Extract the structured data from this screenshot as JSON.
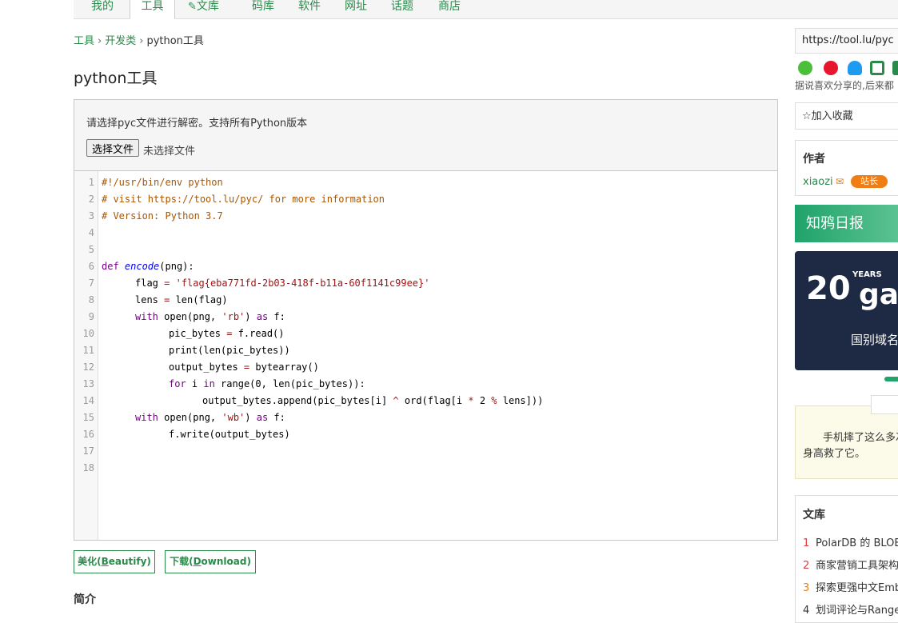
{
  "topnav": {
    "items": [
      "我的",
      "工具",
      "文库",
      "码库",
      "软件",
      "网址",
      "话题",
      "商店"
    ],
    "active_index": 1
  },
  "breadcrumb": [
    "工具",
    "开发类",
    "python工具"
  ],
  "page_title": "python工具",
  "panel": {
    "hint": "请选择pyc文件进行解密。支持所有Python版本",
    "file_button": "选择文件",
    "file_status": "未选择文件"
  },
  "editor": {
    "line_numbers": [
      "1",
      "2",
      "3",
      "4",
      "5",
      "6",
      "7",
      "8",
      "9",
      "10",
      "11",
      "12",
      "13",
      "14",
      "15",
      "16",
      "17",
      "18"
    ],
    "lines": [
      {
        "indent": 0,
        "parts": [
          {
            "t": "#!/usr/bin/env python",
            "c": "cm"
          }
        ]
      },
      {
        "indent": 0,
        "parts": [
          {
            "t": "# visit https://tool.lu/pyc/ for more information",
            "c": "cm"
          }
        ]
      },
      {
        "indent": 0,
        "parts": [
          {
            "t": "# Version: Python 3.7",
            "c": "cm"
          }
        ]
      },
      {
        "indent": 0,
        "parts": []
      },
      {
        "indent": 0,
        "parts": []
      },
      {
        "indent": 0,
        "parts": [
          {
            "t": "def ",
            "c": "kw"
          },
          {
            "t": "encode",
            "c": "fn"
          },
          {
            "t": "(png):",
            "c": ""
          }
        ]
      },
      {
        "indent": 1,
        "parts": [
          {
            "t": "flag ",
            "c": ""
          },
          {
            "t": "=",
            "c": "op"
          },
          {
            "t": " ",
            "c": ""
          },
          {
            "t": "'flag{eba771fd-2b03-418f-b11a-60f1141c99ee}'",
            "c": "str"
          }
        ]
      },
      {
        "indent": 1,
        "parts": [
          {
            "t": "lens ",
            "c": ""
          },
          {
            "t": "=",
            "c": "op"
          },
          {
            "t": " len(flag)",
            "c": ""
          }
        ]
      },
      {
        "indent": 1,
        "parts": [
          {
            "t": "with ",
            "c": "kw"
          },
          {
            "t": "open(png, ",
            "c": ""
          },
          {
            "t": "'rb'",
            "c": "str"
          },
          {
            "t": ") ",
            "c": ""
          },
          {
            "t": "as",
            "c": "kw"
          },
          {
            "t": " f:",
            "c": ""
          }
        ]
      },
      {
        "indent": 2,
        "parts": [
          {
            "t": "pic_bytes ",
            "c": ""
          },
          {
            "t": "=",
            "c": "op"
          },
          {
            "t": " f.read()",
            "c": ""
          }
        ]
      },
      {
        "indent": 2,
        "parts": [
          {
            "t": "print(len(pic_bytes))",
            "c": ""
          }
        ]
      },
      {
        "indent": 2,
        "parts": [
          {
            "t": "output_bytes ",
            "c": ""
          },
          {
            "t": "=",
            "c": "op"
          },
          {
            "t": " bytearray()",
            "c": ""
          }
        ]
      },
      {
        "indent": 2,
        "parts": [
          {
            "t": "for ",
            "c": "kw"
          },
          {
            "t": "i ",
            "c": ""
          },
          {
            "t": "in ",
            "c": "kw"
          },
          {
            "t": "range(0, len(pic_bytes)):",
            "c": ""
          }
        ]
      },
      {
        "indent": 3,
        "parts": [
          {
            "t": "output_bytes.append(pic_bytes[i] ",
            "c": ""
          },
          {
            "t": "^",
            "c": "op"
          },
          {
            "t": " ord(flag[i ",
            "c": ""
          },
          {
            "t": "*",
            "c": "op"
          },
          {
            "t": " 2 ",
            "c": ""
          },
          {
            "t": "%",
            "c": "op"
          },
          {
            "t": " lens]))",
            "c": ""
          }
        ]
      },
      {
        "indent": 1,
        "parts": [
          {
            "t": "with ",
            "c": "kw"
          },
          {
            "t": "open(png, ",
            "c": ""
          },
          {
            "t": "'wb'",
            "c": "str"
          },
          {
            "t": ") ",
            "c": ""
          },
          {
            "t": "as",
            "c": "kw"
          },
          {
            "t": " f:",
            "c": ""
          }
        ]
      },
      {
        "indent": 2,
        "parts": [
          {
            "t": "f.write(output_bytes)",
            "c": ""
          }
        ]
      },
      {
        "indent": 0,
        "parts": []
      },
      {
        "indent": 0,
        "parts": []
      }
    ]
  },
  "actions": {
    "beautify_prefix": "美化(",
    "beautify_key": "B",
    "beautify_rest": "eautify)",
    "download_prefix": "下载(",
    "download_key": "D",
    "download_rest": "ownload)"
  },
  "intro_title": "简介",
  "sidebar": {
    "url": "https://tool.lu/pyc",
    "share_icons": [
      "wechat-icon",
      "weibo-icon",
      "qq-icon",
      "qrcode-icon",
      "share-icon"
    ],
    "share_note": "据说喜欢分享的,后来都",
    "favorite": "加入收藏",
    "author_heading": "作者",
    "author_name": "xiaozi",
    "author_badge": "站长",
    "daily_title": "知鸦日报",
    "ad": {
      "years_num": "20",
      "years_label": "YEARS",
      "brand": "ga",
      "text": "国别域名"
    },
    "quote_line1": "手机摔了这么多次",
    "quote_line2": "身高救了它。",
    "library_heading": "文库",
    "library_items": [
      {
        "num": "1",
        "title": "PolarDB 的 BLOB"
      },
      {
        "num": "2",
        "title": "商家营销工具架构"
      },
      {
        "num": "3",
        "title": "探索更强中文Emb"
      },
      {
        "num": "4",
        "title": "划词评论与Range"
      }
    ],
    "colors": {
      "accent": "#2a8a4a",
      "num_red": "#e03a3a",
      "num_orange": "#f07e14"
    }
  }
}
